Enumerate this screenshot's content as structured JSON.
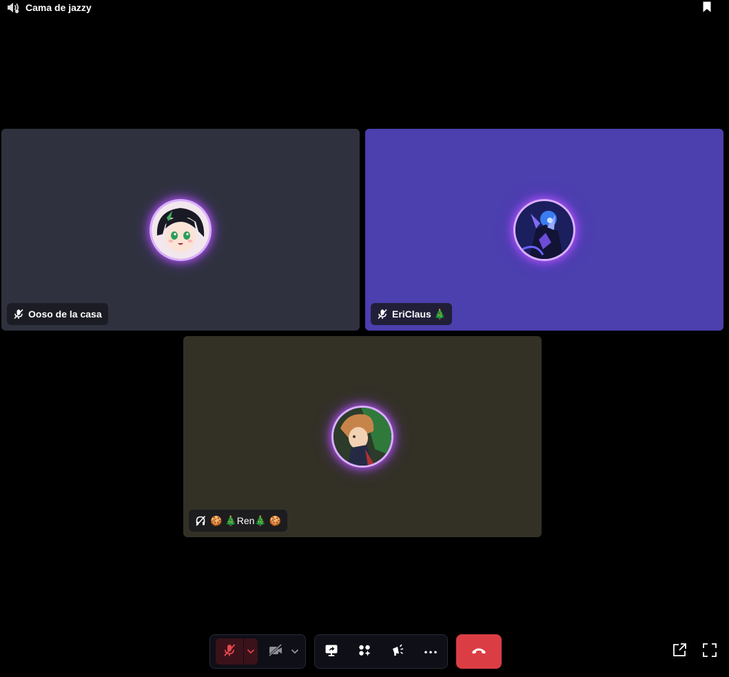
{
  "header": {
    "channel_icon": "speaker-stage-icon",
    "title": "Cama de jazzy",
    "bookmark_icon": "bookmark-icon"
  },
  "participants": [
    {
      "name": "Ooso de la casa",
      "status_icon": "mic-muted-icon",
      "tile_color": "#2f323e",
      "avatar": "anime-boy-green-eyes-avatar"
    },
    {
      "name": "EriClaus 🎄",
      "status_icon": "mic-muted-icon",
      "tile_color": "#4c3fae",
      "avatar": "dark-blue-character-avatar"
    },
    {
      "name": "🍪 🎄Ren🎄 🍪",
      "status_icon": "deafened-icon",
      "tile_color": "#333126",
      "avatar": "orange-green-character-avatar"
    }
  ],
  "controls": {
    "microphone": {
      "state": "muted",
      "icon": "mic-muted-icon"
    },
    "camera": {
      "state": "off",
      "icon": "camera-off-icon"
    },
    "activities": [
      "screen-share-icon",
      "activities-icon",
      "soundboard-icon",
      "more-icon"
    ],
    "hangup_icon": "phone-hangup-icon",
    "popout_icon": "popout-icon",
    "fullscreen_icon": "fullscreen-icon"
  },
  "colors": {
    "background": "#000000",
    "hangup": "#da3e44",
    "muted_bg": "#3b121a",
    "muted_icon": "#e8454d",
    "avatar_glow": "#c45cff"
  }
}
